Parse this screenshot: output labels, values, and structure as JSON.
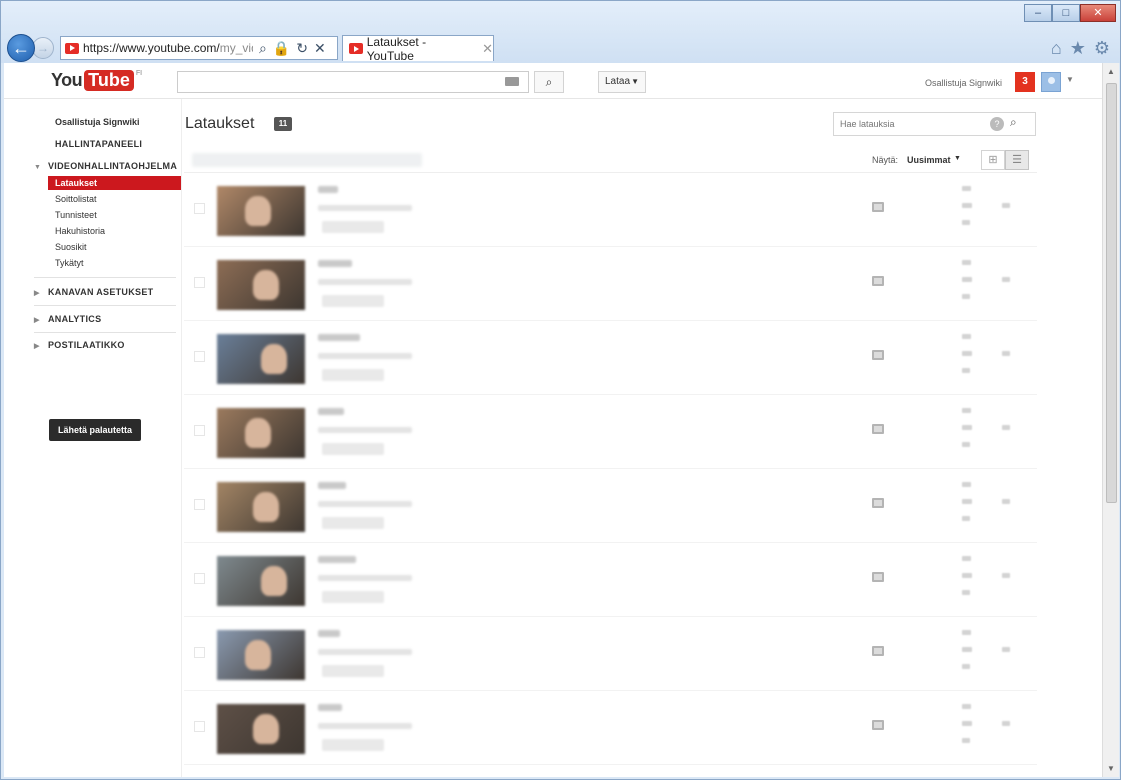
{
  "browser": {
    "url_main": "https://www.youtube.com/",
    "url_tail": "my_vide",
    "tab_title": "Lataukset - YouTube",
    "win_min": "–",
    "win_max": "□",
    "win_close": "✕",
    "back_glyph": "←",
    "fwd_glyph": "→",
    "addr_search_glyph": "⌕",
    "addr_lock_glyph": "🔒",
    "addr_refresh_glyph": "↻",
    "addr_stop_glyph": "✕",
    "tab_close_glyph": "✕",
    "home_glyph": "⌂",
    "favorites_glyph": "★",
    "tools_glyph": "⚙"
  },
  "masthead": {
    "logo_you": "You",
    "logo_tube": "Tube",
    "logo_sup": "FI",
    "search_value": "",
    "search_glyph": "⌕",
    "upload_label": "Lataa",
    "account_name": "Osallistuja Signwiki",
    "notification_count": "3"
  },
  "sidebar": {
    "user": "Osallistuja Signwiki",
    "dashboard": "HALLINTAPANEELI",
    "video_manager": "VIDEONHALLINTAOHJELMA",
    "items": [
      "Lataukset",
      "Soittolistat",
      "Tunnisteet",
      "Hakuhistoria",
      "Suosikit",
      "Tykätyt"
    ],
    "channel_settings": "KANAVAN ASETUKSET",
    "analytics": "ANALYTICS",
    "inbox": "POSTILAATIKKO",
    "feedback_button": "Lähetä palautetta"
  },
  "content": {
    "title": "Lataukset",
    "count": "11",
    "search_placeholder": "Hae latauksia",
    "sort_label": "Näytä:",
    "sort_value": "Uusimmat",
    "caret": "▼"
  },
  "videos": [
    {
      "thumb_color": "#b08868"
    },
    {
      "thumb_color": "#8d6d55"
    },
    {
      "thumb_color": "#6a7f99"
    },
    {
      "thumb_color": "#9b7a5e"
    },
    {
      "thumb_color": "#a38565"
    },
    {
      "thumb_color": "#7f8a8f"
    },
    {
      "thumb_color": "#8a9ab0"
    },
    {
      "thumb_color": "#5e5047"
    }
  ]
}
